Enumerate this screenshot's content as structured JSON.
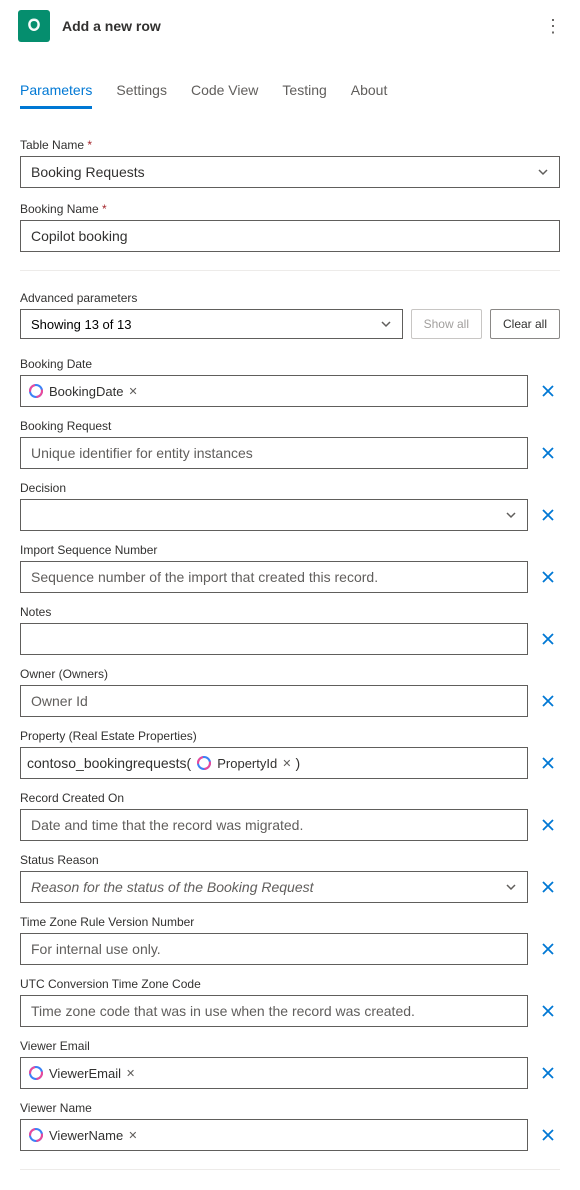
{
  "header": {
    "title": "Add a new row"
  },
  "tabs": [
    {
      "label": "Parameters",
      "active": true
    },
    {
      "label": "Settings",
      "active": false
    },
    {
      "label": "Code View",
      "active": false
    },
    {
      "label": "Testing",
      "active": false
    },
    {
      "label": "About",
      "active": false
    }
  ],
  "main_fields": {
    "table_name": {
      "label": "Table Name",
      "value": "Booking Requests"
    },
    "booking_name": {
      "label": "Booking Name",
      "value": "Copilot booking"
    }
  },
  "advanced": {
    "title": "Advanced parameters",
    "showing": "Showing 13 of 13",
    "show_all": "Show all",
    "clear_all": "Clear all"
  },
  "params": {
    "booking_date": {
      "label": "Booking Date",
      "token": "BookingDate"
    },
    "booking_request": {
      "label": "Booking Request",
      "placeholder": "Unique identifier for entity instances"
    },
    "decision": {
      "label": "Decision"
    },
    "import_seq": {
      "label": "Import Sequence Number",
      "placeholder": "Sequence number of the import that created this record."
    },
    "notes": {
      "label": "Notes"
    },
    "owner": {
      "label": "Owner (Owners)",
      "placeholder": "Owner Id"
    },
    "property": {
      "label": "Property (Real Estate Properties)",
      "prefix": "contoso_bookingrequests(",
      "token": "PropertyId",
      "suffix": ")"
    },
    "record_created": {
      "label": "Record Created On",
      "placeholder": "Date and time that the record was migrated."
    },
    "status_reason": {
      "label": "Status Reason",
      "placeholder": "Reason for the status of the Booking Request"
    },
    "tz_rule": {
      "label": "Time Zone Rule Version Number",
      "placeholder": "For internal use only."
    },
    "utc_conv": {
      "label": "UTC Conversion Time Zone Code",
      "placeholder": "Time zone code that was in use when the record was created."
    },
    "viewer_email": {
      "label": "Viewer Email",
      "token": "ViewerEmail"
    },
    "viewer_name": {
      "label": "Viewer Name",
      "token": "ViewerName"
    }
  }
}
